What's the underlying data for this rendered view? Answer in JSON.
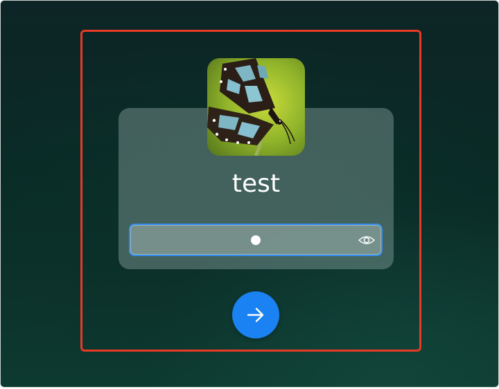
{
  "login": {
    "username": "test",
    "password_masked": "•"
  },
  "icons": {
    "avatar": "butterfly-avatar",
    "reveal_password": "eye-icon",
    "submit": "arrow-right-icon"
  },
  "colors": {
    "accent": "#1a82f2",
    "highlight_border": "#e83a25",
    "field_focus_border": "#2f8df4"
  }
}
